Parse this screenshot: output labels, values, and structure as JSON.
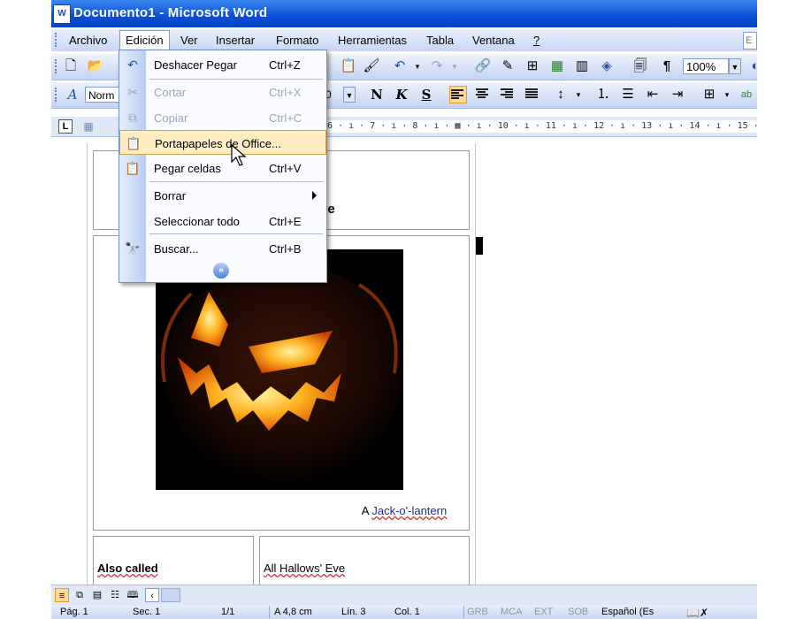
{
  "window": {
    "title": "Documento1 - Microsoft Word",
    "app_icon": "W"
  },
  "menubar": {
    "items": [
      "Archivo",
      "Edición",
      "Ver",
      "Insertar",
      "Formato",
      "Herramientas",
      "Tabla",
      "Ventana",
      "?"
    ],
    "active": "Edición",
    "ask_box": "E"
  },
  "toolbar": {
    "zoom": "100%",
    "style": "Norm",
    "font_size": "0",
    "bold": "N",
    "italic": "K",
    "underline": "S"
  },
  "ruler": {
    "ticks": "· 6 · ı · 7 · ı · 8 · ı · ▦ · ı · 10 · ı · 11 · ı · 12 · ı · 13 · ı · 14 · ı · 15 · ı ·"
  },
  "edit_menu": {
    "items": [
      {
        "label": "Deshacer Pegar",
        "shortcut": "Ctrl+Z",
        "icon": "undo-icon",
        "enabled": true
      },
      {
        "label": "Cortar",
        "shortcut": "Ctrl+X",
        "icon": "scissors-icon",
        "enabled": false
      },
      {
        "label": "Copiar",
        "shortcut": "Ctrl+C",
        "icon": "copy-icon",
        "enabled": false
      },
      {
        "label": "Portapapeles de Office...",
        "shortcut": "",
        "icon": "clipboard-icon",
        "enabled": true,
        "highlighted": true
      },
      {
        "label": "Pegar celdas",
        "shortcut": "Ctrl+V",
        "icon": "paste-icon",
        "enabled": true
      },
      {
        "label": "Borrar",
        "shortcut": "",
        "icon": "",
        "enabled": true,
        "submenu": true
      },
      {
        "label": "Seleccionar todo",
        "shortcut": "Ctrl+E",
        "icon": "",
        "enabled": true
      },
      {
        "label": "Buscar...",
        "shortcut": "Ctrl+B",
        "icon": "binoculars-icon",
        "enabled": true
      }
    ]
  },
  "document": {
    "title_fragment": "ve",
    "caption_prefix": "A",
    "caption_link": "Jack-o'-lantern",
    "row_label": "Also called",
    "row_value": "All Hallows' Eve"
  },
  "status": {
    "page": "Pág. 1",
    "section": "Sec. 1",
    "pages": "1/1",
    "at": "A 4,8 cm",
    "line": "Lín. 3",
    "col": "Col. 1",
    "grb": "GRB",
    "mca": "MCA",
    "ext": "EXT",
    "sob": "SOB",
    "language": "Español (Es"
  },
  "colors": {
    "title_bar": "#0a4fd6",
    "menu_highlight": "#ffeec2",
    "pumpkin_glow": "#ffb020"
  }
}
